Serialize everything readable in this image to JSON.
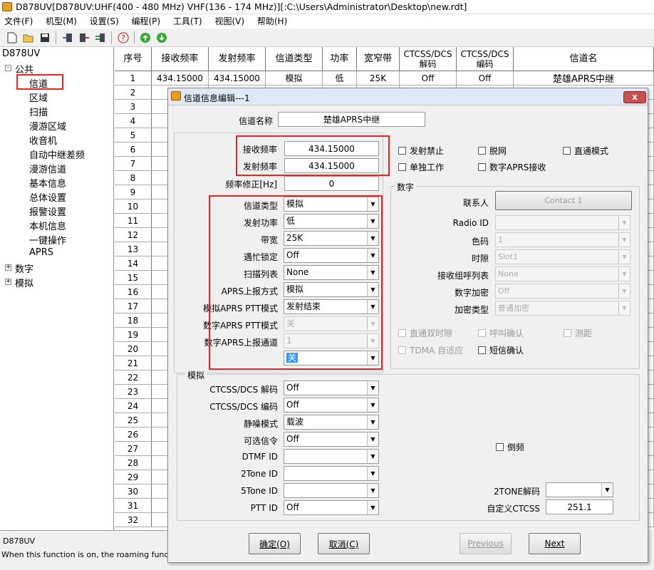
{
  "window": {
    "title": "D878UV[D878UV:UHF(400 - 480 MHz) VHF(136 - 174 MHz)][:C:\\Users\\Administrator\\Desktop\\new.rdt]"
  },
  "menu": [
    "文件(F)",
    "机型(M)",
    "设置(S)",
    "编程(P)",
    "工具(T)",
    "视图(V)",
    "帮助(H)"
  ],
  "tree": {
    "root": "D878UV",
    "public": "公共",
    "public_children": [
      "信道",
      "区域",
      "扫描",
      "漫游区域",
      "收音机",
      "自动中继差频",
      "漫游信道",
      "基本信息",
      "总体设置",
      "报警设置",
      "本机信息",
      "一键操作",
      "APRS"
    ],
    "digital": "数字",
    "analog": "模拟"
  },
  "grid": {
    "headers": [
      "序号",
      "接收频率",
      "发射频率",
      "信道类型",
      "功率",
      "宽窄带",
      "CTCSS/DCS 解码",
      "CTCSS/DCS 编码",
      "信道名"
    ],
    "row1": [
      "1",
      "434.15000",
      "434.15000",
      "模拟",
      "低",
      "25K",
      "Off",
      "Off",
      "楚雄APRS中继"
    ],
    "row_numbers": [
      "2",
      "3",
      "4",
      "5",
      "6",
      "7",
      "8",
      "9",
      "10",
      "11",
      "12",
      "13",
      "14",
      "15",
      "16",
      "17",
      "18",
      "19",
      "20",
      "21",
      "22",
      "23",
      "24",
      "25",
      "26",
      "27",
      "28",
      "29",
      "30",
      "31",
      "32"
    ]
  },
  "status": {
    "device": "D878UV",
    "help": "When this function is on, the roaming function is i"
  },
  "dialog": {
    "title": "信道信息编辑---1",
    "close": "x",
    "channel_name_label": "信道名称",
    "channel_name": "楚雄APRS中继",
    "rx_freq_label": "接收频率",
    "rx_freq": "434.15000",
    "tx_freq_label": "发射频率",
    "tx_freq": "434.15000",
    "freq_corr_label": "频率修正[Hz]",
    "freq_corr": "0",
    "fields": [
      {
        "label": "信道类型",
        "value": "模拟",
        "disabled": false
      },
      {
        "label": "发射功率",
        "value": "低",
        "disabled": false
      },
      {
        "label": "带宽",
        "value": "25K",
        "disabled": false
      },
      {
        "label": "遇忙锁定",
        "value": "Off",
        "disabled": false
      },
      {
        "label": "扫描列表",
        "value": "None",
        "disabled": false
      },
      {
        "label": "APRS上报方式",
        "value": "模拟",
        "disabled": false
      },
      {
        "label": "模拟APRS PTT模式",
        "value": "发射结束",
        "disabled": false
      },
      {
        "label": "数字APRS PTT模式",
        "value": "关",
        "disabled": true
      },
      {
        "label": "数字APRS上报通道",
        "value": "1",
        "disabled": true
      },
      {
        "label": "",
        "value": "关",
        "disabled": false
      }
    ],
    "checks_top": [
      "发射禁止",
      "脱网",
      "直通模式",
      "单独工作",
      "数字APRS接收"
    ],
    "digital": {
      "title": "数字",
      "contact_label": "联系人",
      "contact_button": "Contact 1",
      "rows": [
        {
          "label": "Radio ID",
          "value": ""
        },
        {
          "label": "色码",
          "value": "1"
        },
        {
          "label": "时隙",
          "value": "Slot1"
        },
        {
          "label": "接收组呼列表",
          "value": "None"
        },
        {
          "label": "数字加密",
          "value": "Off"
        },
        {
          "label": "加密类型",
          "value": "普通加密"
        }
      ],
      "checks": [
        "直通双时隙",
        "呼叫确认",
        "测距",
        "TDMA 自适应",
        "短信确认"
      ]
    },
    "analog": {
      "title": "模拟",
      "rows": [
        {
          "label": "CTCSS/DCS 解码",
          "value": "Off"
        },
        {
          "label": "CTCSS/DCS 编码",
          "value": "Off"
        },
        {
          "label": "静噪模式",
          "value": "载波"
        },
        {
          "label": "可选信令",
          "value": "Off"
        },
        {
          "label": "DTMF ID",
          "value": ""
        },
        {
          "label": "2Tone ID",
          "value": ""
        },
        {
          "label": "5Tone ID",
          "value": ""
        },
        {
          "label": "PTT ID",
          "value": "Off"
        }
      ],
      "reverse": "倒频",
      "twotone_label": "2TONE解码",
      "twotone_value": "",
      "custom_ctcss_label": "自定义CTCSS",
      "custom_ctcss": "251.1"
    },
    "buttons": {
      "ok": "确定(O)",
      "cancel": "取消(C)",
      "previous": "Previous",
      "next": "Next"
    }
  }
}
